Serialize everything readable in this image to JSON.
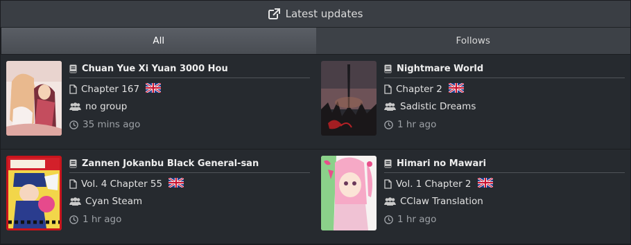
{
  "header": {
    "title": "Latest updates",
    "icon": "external-link-icon"
  },
  "tabs": [
    {
      "label": "All",
      "active": true
    },
    {
      "label": "Follows",
      "active": false
    }
  ],
  "updates": [
    {
      "title": "Chuan Yue Xi Yuan 3000 Hou",
      "chapter": "Chapter 167",
      "group": "no group",
      "time": "35 mins ago",
      "flag": "uk-flag-icon"
    },
    {
      "title": "Nightmare World",
      "chapter": "Chapter 2",
      "group": "Sadistic Dreams",
      "time": "1 hr ago",
      "flag": "uk-flag-icon"
    },
    {
      "title": "Zannen Jokanbu Black General-san",
      "chapter": "Vol. 4 Chapter 55",
      "group": "Cyan Steam",
      "time": "1 hr ago",
      "flag": "uk-flag-icon"
    },
    {
      "title": "Himari no Mawari",
      "chapter": "Vol. 1 Chapter 2",
      "group": "CClaw Translation",
      "time": "1 hr ago",
      "flag": "uk-flag-icon"
    }
  ],
  "colors": {
    "panel_bg": "#262a2f",
    "tab_active": "#52565c",
    "time_text": "#9da1a6"
  }
}
